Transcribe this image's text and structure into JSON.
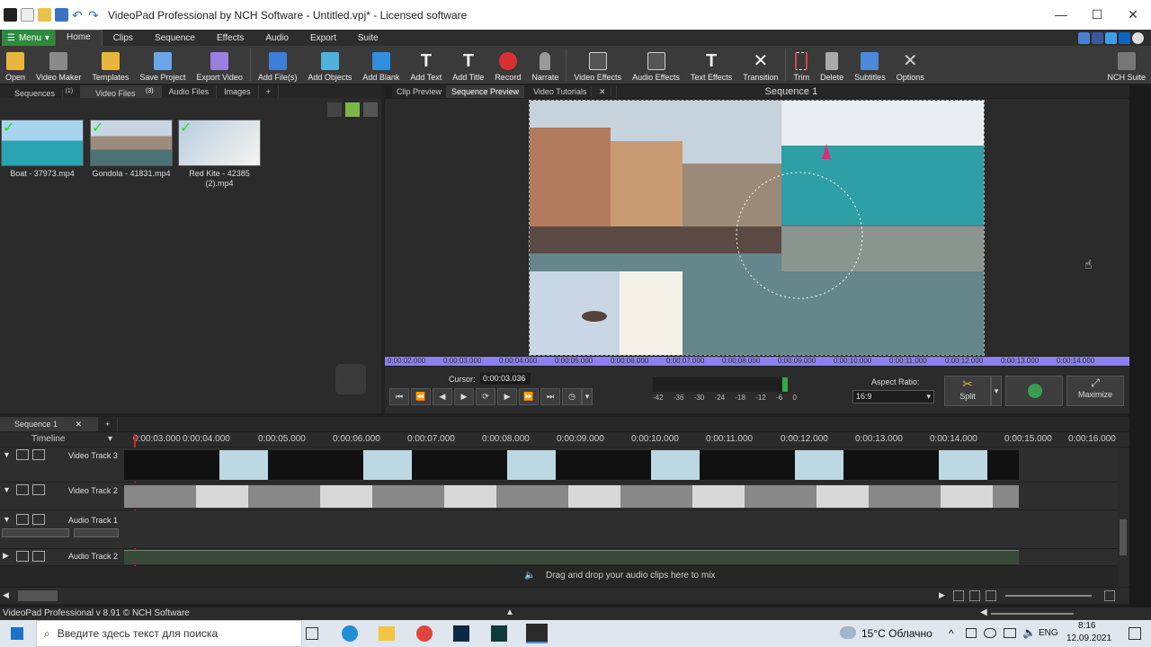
{
  "window": {
    "title": "VideoPad Professional by NCH Software - Untitled.vpj* - Licensed software",
    "minimize": "—",
    "maximize": "☐",
    "close": "✕"
  },
  "menu": {
    "menu_label": "Menu",
    "tabs": [
      "Home",
      "Clips",
      "Sequence",
      "Effects",
      "Audio",
      "Export",
      "Suite"
    ],
    "active_tab": "Home"
  },
  "toolbar": {
    "items": [
      {
        "label": "Open",
        "icon": "folder-open-icon",
        "color": "#e8b63c"
      },
      {
        "label": "Video Maker",
        "icon": "magic-wand-icon",
        "color": "#c8c8c8"
      },
      {
        "label": "Templates",
        "icon": "templates-folder-icon",
        "color": "#e8b63c"
      },
      {
        "label": "Save Project",
        "icon": "save-disk-icon",
        "color": "#6aa6e8"
      },
      {
        "label": "Export Video",
        "icon": "export-video-icon",
        "color": "#9a7ee0"
      },
      {
        "label": "Add File(s)",
        "icon": "add-file-icon",
        "color": "#3d7fd8"
      },
      {
        "label": "Add Objects",
        "icon": "add-objects-icon",
        "color": "#4fb3d9"
      },
      {
        "label": "Add Blank",
        "icon": "add-blank-icon",
        "color": "#2f8ee0"
      },
      {
        "label": "Add Text",
        "icon": "text-icon",
        "color": "#e8e8e8"
      },
      {
        "label": "Add Title",
        "icon": "title-icon",
        "color": "#e8e8e8"
      },
      {
        "label": "Record",
        "icon": "record-icon",
        "color": "#d83030"
      },
      {
        "label": "Narrate",
        "icon": "microphone-icon",
        "color": "#aaaaaa"
      },
      {
        "label": "Video Effects",
        "icon": "video-effects-icon",
        "color": "#cfcfcf"
      },
      {
        "label": "Audio Effects",
        "icon": "audio-effects-icon",
        "color": "#cfcfcf"
      },
      {
        "label": "Text Effects",
        "icon": "text-effects-icon",
        "color": "#e8e8e8"
      },
      {
        "label": "Transition",
        "icon": "transition-icon",
        "color": "#e8e8e8"
      },
      {
        "label": "Trim",
        "icon": "trim-icon",
        "color": "#d04848"
      },
      {
        "label": "Delete",
        "icon": "trash-icon",
        "color": "#bbbbbb"
      },
      {
        "label": "Subtitles",
        "icon": "subtitles-icon",
        "color": "#4a8ad8"
      },
      {
        "label": "Options",
        "icon": "options-tools-icon",
        "color": "#cccccc"
      },
      {
        "label": "NCH Suite",
        "icon": "nch-suite-icon",
        "color": "#cccccc"
      }
    ]
  },
  "bin": {
    "tabs": [
      {
        "label": "Sequences",
        "count": "(1)"
      },
      {
        "label": "Video Files",
        "count": "(3)"
      },
      {
        "label": "Audio Files",
        "count": ""
      },
      {
        "label": "Images",
        "count": ""
      },
      {
        "label": "+",
        "count": ""
      }
    ],
    "files": [
      {
        "name": "Boat - 37973.mp4"
      },
      {
        "name": "Gondola - 41831.mp4"
      },
      {
        "name": "Red Kite - 42385 (2).mp4"
      }
    ]
  },
  "preview": {
    "tabs": [
      "Clip Preview",
      "Sequence Preview",
      "Video Tutorials"
    ],
    "active_tab": "Sequence Preview",
    "sequence_title": "Sequence 1",
    "ruler_ticks": [
      "0:00:02.000",
      "0:00:03.000",
      "0:00:04.000",
      "0:00:05.000",
      "0:00:06.000",
      "0:00:07.000",
      "0:00:08.000",
      "0:00:09.000",
      "0:00:10.000",
      "0:00:11.000",
      "0:00:12.000",
      "0:00:13.000",
      "0:00:14.000"
    ],
    "cursor_label": "Cursor:",
    "cursor_value": "0:00:03.036",
    "meter_labels": [
      "-42",
      "-36",
      "-30",
      "-24",
      "-18",
      "-12",
      "-6",
      "0"
    ],
    "aspect_label": "Aspect Ratio:",
    "aspect_value": "16:9",
    "split_label": "Split",
    "maximize_label": "Maximize"
  },
  "timeline": {
    "sequence_tab": "Sequence 1",
    "timeline_label": "Timeline",
    "ticks": [
      "0:00:03.000",
      "0:00:04.000",
      "0:00:05.000",
      "0:00:06.000",
      "0:00:07.000",
      "0:00:08.000",
      "0:00:09.000",
      "0:00:10.000",
      "0:00:11.000",
      "0:00:12.000",
      "0:00:13.000",
      "0:00:14.000",
      "0:00:15.000",
      "0:00:16.000"
    ],
    "tracks": [
      {
        "name": "Video Track 3"
      },
      {
        "name": "Video Track 2"
      },
      {
        "name": "Audio Track 1"
      },
      {
        "name": "Audio Track 2"
      }
    ],
    "drop_hint": "Drag and drop your audio clips here to mix"
  },
  "status": {
    "text": "VideoPad Professional v 8.91 © NCH Software"
  },
  "taskbar": {
    "search_placeholder": "Введите здесь текст для поиска",
    "weather": "15°C  Облачно",
    "lang": "ENG",
    "time": "8:16",
    "date": "12.09.2021"
  }
}
